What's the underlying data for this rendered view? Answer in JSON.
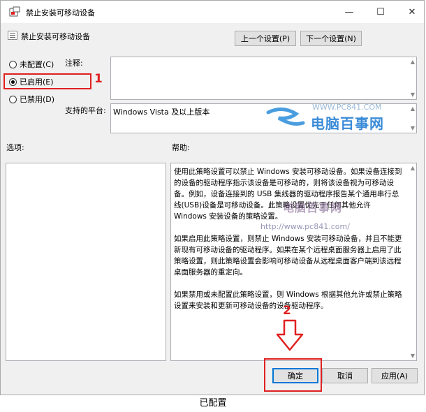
{
  "window": {
    "title": "禁止安装可移动设备",
    "minimize_glyph": "—",
    "maximize_glyph": "☐",
    "close_glyph": "✕"
  },
  "header": {
    "policy_name": "禁止安装可移动设备",
    "prev_setting": "上一个设置(P)",
    "next_setting": "下一个设置(N)"
  },
  "options": {
    "not_configured": "未配置(C)",
    "enabled": "已启用(E)",
    "disabled": "已禁用(D)",
    "selected": "enabled"
  },
  "comment": {
    "label": "注释:",
    "value": ""
  },
  "supported": {
    "label": "支持的平台:",
    "value": "Windows Vista 及以上版本"
  },
  "sections": {
    "options_label": "选项:",
    "help_label": "帮助:"
  },
  "help": {
    "paragraphs": [
      "使用此策略设置可以禁止 Windows 安装可移动设备。如果设备连接到的设备的驱动程序指示该设备是可移动的，则将该设备视为可移动设备。例如，设备连接到的 USB 集线器的驱动程序报告某个通用串行总线(USB)设备是可移动设备。此策略设置优先于任何其他允许 Windows 安装设备的策略设置。",
      "如果启用此策略设置，则禁止 Windows 安装可移动设备，并且不能更新现有可移动设备的驱动程序。如果在某个远程桌面服务器上启用了此策略设置，则此策略设置会影响可移动设备从远程桌面客户端到该远程桌面服务器的重定向。",
      "如果禁用或未配置此策略设置，则 Windows 根据其他允许或禁止策略设置来安装和更新可移动设备的设备驱动程序。"
    ]
  },
  "footer": {
    "ok": "确定",
    "cancel": "取消",
    "apply": "应用(A)"
  },
  "annotations": {
    "marker_1": "1",
    "marker_2": "2",
    "color": "#e02020"
  },
  "watermark": {
    "url_top": "WWW.PC841.COM",
    "brand_top": "电脑百事网",
    "brand_mid": "电脑百事网",
    "url_mid": "http://www.pc841.com/"
  },
  "caption": "已配置"
}
